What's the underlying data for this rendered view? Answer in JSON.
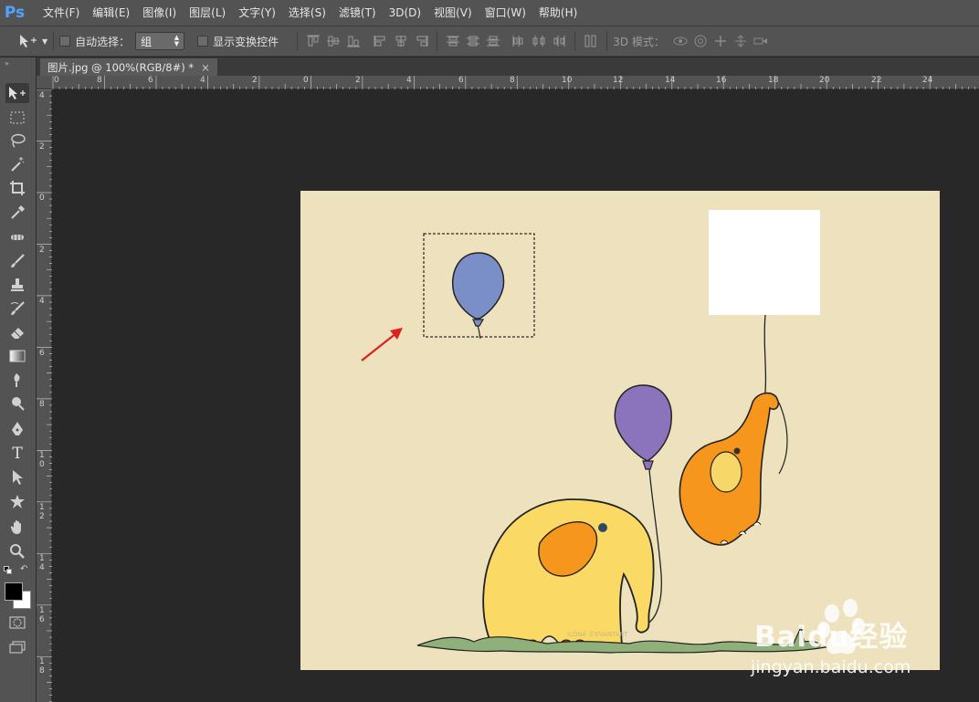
{
  "app": {
    "logo": "Ps"
  },
  "menu": [
    "文件(F)",
    "编辑(E)",
    "图像(I)",
    "图层(L)",
    "文字(Y)",
    "选择(S)",
    "滤镜(T)",
    "3D(D)",
    "视图(V)",
    "窗口(W)",
    "帮助(H)"
  ],
  "options": {
    "auto_select_label": "自动选择：",
    "auto_select_value": "组",
    "show_transform_label": "显示变换控件",
    "mode_3d_label": "3D 模式："
  },
  "document": {
    "tab_title": "图片.jpg @ 100%(RGB/8#) *",
    "close": "×"
  },
  "ruler": {
    "top": [
      "0",
      "8",
      "6",
      "4",
      "2",
      "0",
      "2",
      "4",
      "6",
      "8",
      "10",
      "12",
      "14",
      "16",
      "18",
      "20",
      "22",
      "24"
    ],
    "left": [
      "4",
      "2",
      "0",
      "2",
      "4",
      "6",
      "8",
      "1\n0",
      "1\n2",
      "1\n4",
      "1\n6",
      "1\n8"
    ]
  },
  "tools": [
    "move-tool",
    "marquee-tool",
    "lasso-tool",
    "magic-wand-tool",
    "crop-tool",
    "eyedropper-tool",
    "healing-brush-tool",
    "brush-tool",
    "clone-stamp-tool",
    "history-brush-tool",
    "eraser-tool",
    "gradient-tool",
    "blur-tool",
    "dodge-tool",
    "pen-tool",
    "type-tool",
    "path-selection-tool",
    "custom-shape-tool",
    "hand-tool",
    "zoom-tool"
  ],
  "tool_labels": {
    "type": "T"
  },
  "colors": {
    "foreground": "#000000",
    "background": "#ffffff",
    "canvas_bg": "#ede2bd",
    "arrow": "#e02020",
    "selected_balloon": "#7a8fc8"
  },
  "artwork": {
    "credit": "ILONA ©EVANTART"
  },
  "watermark": {
    "brand": "Baidu经验",
    "url": "jingyan.baidu.com"
  }
}
